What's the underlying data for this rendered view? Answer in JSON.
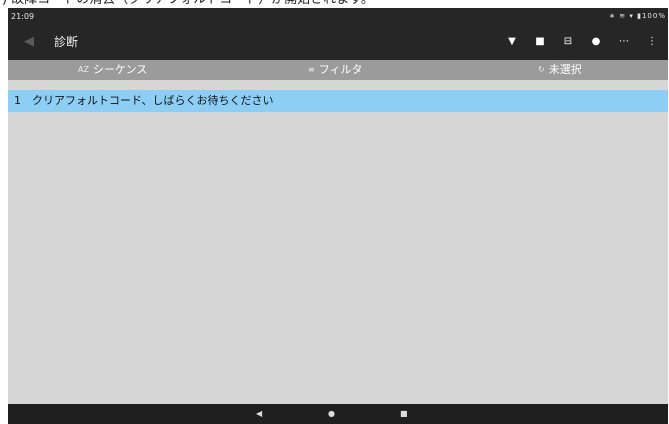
{
  "caption": ") 故障コードの消去（クリアフォルトコード）が開始されます。",
  "status_bar": {
    "time": "21:09",
    "system_icons": "∗ ≋ ▾ ▮100%"
  },
  "app_bar": {
    "title": "診断",
    "back_glyph": "◀",
    "actions": [
      {
        "name": "wifi-icon",
        "glyph": "▼"
      },
      {
        "name": "camera-icon",
        "glyph": "■"
      },
      {
        "name": "print-icon",
        "glyph": "⊟"
      },
      {
        "name": "settings-icon",
        "glyph": "●"
      },
      {
        "name": "grid-icon",
        "glyph": "⋯"
      },
      {
        "name": "more-icon",
        "glyph": "⋮"
      }
    ]
  },
  "toolbar": {
    "sequence": {
      "icon": "AZ",
      "label": "シーケンス"
    },
    "filter": {
      "icon": "≡",
      "label": "フィルタ"
    },
    "unselected": {
      "icon": "↻",
      "label": "未選択"
    }
  },
  "list": [
    {
      "index": "1",
      "text": "クリアフォルトコード、しばらくお待ちください",
      "selected": true
    }
  ],
  "nav_bar": {
    "back": "◀",
    "home": "●",
    "recents": "■"
  },
  "colors": {
    "app_bar": "#262626",
    "toolbar": "#9b9b9b",
    "selected_row": "#8dcff4",
    "background": "#d6d6d6"
  }
}
